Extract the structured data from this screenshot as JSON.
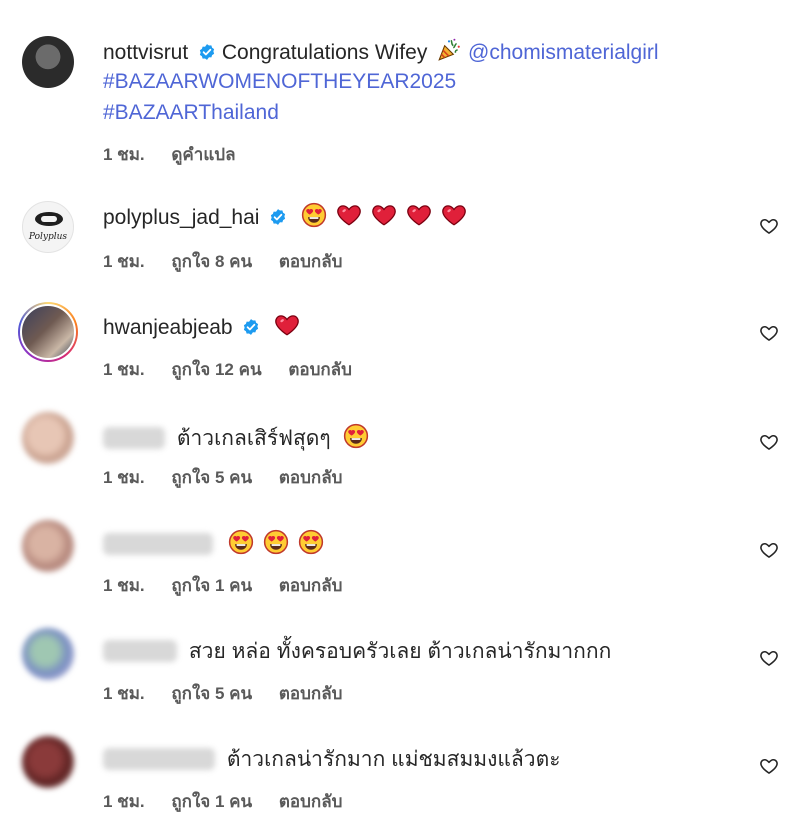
{
  "post": {
    "username": "nottvisrut",
    "caption": "Congratulations Wifey",
    "mention": "@chomismaterialgirl",
    "hashtags": [
      "#BAZAARWOMENOFTHEYEAR2025",
      "#BAZAARThailand"
    ],
    "time": "1 ชม.",
    "translate": "ดูคำแปล",
    "icons": [
      "verified-badge-icon",
      "party-popper-icon"
    ]
  },
  "comments": [
    {
      "username": "polyplus_jad_hai",
      "verified": true,
      "text": "",
      "emojis": [
        "heart-eyes",
        "red-heart",
        "red-heart",
        "red-heart",
        "red-heart"
      ],
      "time": "1 ชม.",
      "likes": "ถูกใจ 8 คน",
      "reply": "ตอบกลับ"
    },
    {
      "username": "hwanjeabjeab",
      "verified": true,
      "text": "",
      "emojis": [
        "red-heart"
      ],
      "time": "1 ชม.",
      "likes": "ถูกใจ 12 คน",
      "reply": "ตอบกลับ"
    },
    {
      "username": "",
      "verified": false,
      "text": "ต้าวเกลเสิร์ฟสุดๆ",
      "emojis": [
        "heart-eyes"
      ],
      "time": "1 ชม.",
      "likes": "ถูกใจ 5 คน",
      "reply": "ตอบกลับ"
    },
    {
      "username": "",
      "verified": false,
      "text": "",
      "emojis": [
        "heart-eyes",
        "heart-eyes",
        "heart-eyes"
      ],
      "time": "1 ชม.",
      "likes": "ถูกใจ 1 คน",
      "reply": "ตอบกลับ"
    },
    {
      "username": "",
      "verified": false,
      "text": "สวย หล่อ ทั้งครอบครัวเลย ต้าวเกลน่ารักมากกก",
      "emojis": [],
      "time": "1 ชม.",
      "likes": "ถูกใจ 5 คน",
      "reply": "ตอบกลับ"
    },
    {
      "username": "",
      "verified": false,
      "text": "ต้าวเกลน่ารักมาก แม่ชมสมมงแล้วตะ",
      "emojis": [],
      "time": "1 ชม.",
      "likes": "ถูกใจ 1 คน",
      "reply": "ตอบกลับ"
    }
  ],
  "colors": {
    "link": "#4f66d6",
    "verified": "#1d9bf0",
    "heart": "#e0203a",
    "text": "#262626",
    "meta": "#5a5a5a"
  }
}
